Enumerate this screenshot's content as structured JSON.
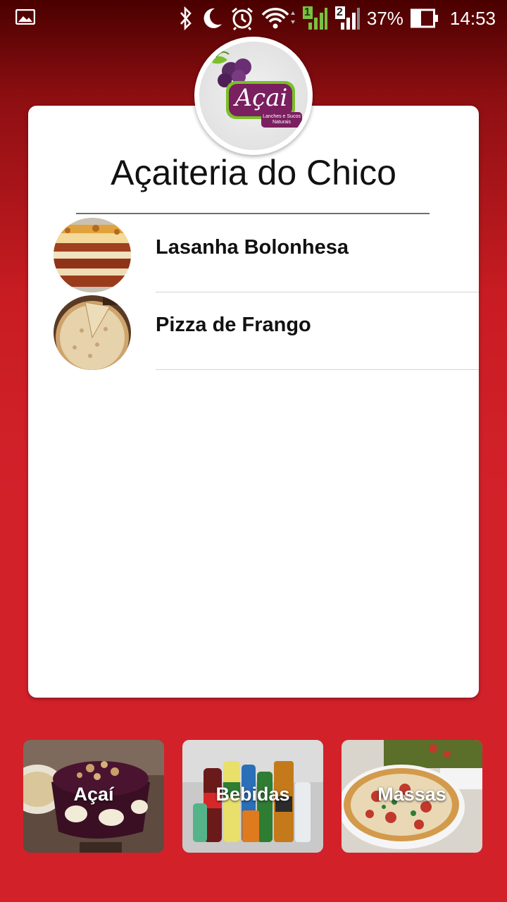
{
  "status_bar": {
    "battery": "37%",
    "time": "14:53",
    "sim1": "1",
    "sim2": "2",
    "icons": [
      "image-icon",
      "bluetooth-icon",
      "moon-icon",
      "alarm-icon",
      "wifi-icon",
      "signal-sim1-icon",
      "signal-sim2-icon",
      "battery-icon"
    ]
  },
  "logo": {
    "brand": "Açai",
    "tagline": "Lanches e Sucos Naturais"
  },
  "restaurant": {
    "name": "Açaiteria do Chico"
  },
  "menu_items": [
    {
      "name": "Lasanha Bolonhesa",
      "image": "lasagna-photo"
    },
    {
      "name": "Pizza de Frango",
      "image": "chicken-pizza-photo"
    }
  ],
  "categories": [
    {
      "label": "Açaí",
      "image": "acai-bowl-photo"
    },
    {
      "label": "Bebidas",
      "image": "drinks-bottles-photo"
    },
    {
      "label": "Massas",
      "image": "pizza-photo"
    }
  ],
  "colors": {
    "background_top": "#4a0000",
    "background_main": "#d3212a",
    "card": "#ffffff",
    "logo_purple": "#5a1e4a",
    "logo_green": "#7bbf2a"
  }
}
